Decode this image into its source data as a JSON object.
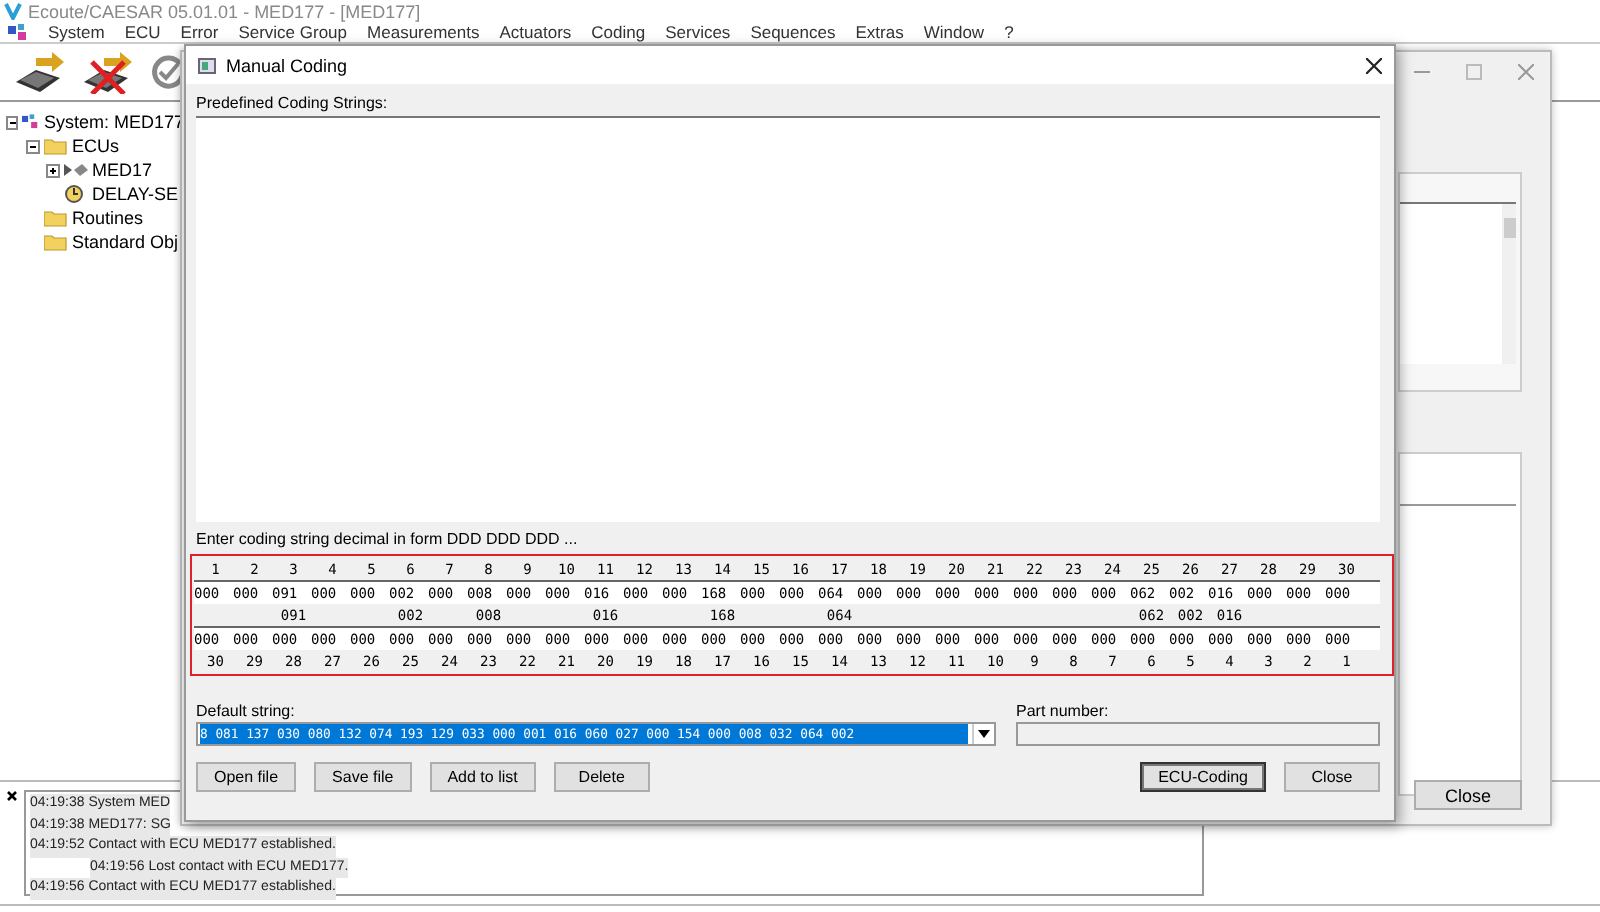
{
  "window": {
    "title": "Ecoute/CAESAR 05.01.01 - MED177 - [MED177]"
  },
  "menu": [
    "System",
    "ECU",
    "Error",
    "Service Group",
    "Measurements",
    "Actuators",
    "Coding",
    "Services",
    "Sequences",
    "Extras",
    "Window",
    "?"
  ],
  "tree": [
    {
      "label": "System: MED177",
      "kind": "system",
      "expanded": true,
      "children": [
        {
          "label": "ECUs",
          "kind": "folder",
          "expanded": true,
          "children": [
            {
              "label": "MED17",
              "kind": "ecu",
              "expanded": false
            },
            {
              "label": "DELAY-SE",
              "kind": "delay"
            }
          ]
        },
        {
          "label": "Routines",
          "kind": "folder"
        },
        {
          "label": "Standard Obj",
          "kind": "folder"
        }
      ]
    }
  ],
  "back_window": {
    "button": "Close"
  },
  "dialog": {
    "title": "Manual Coding",
    "predefined_label": "Predefined Coding Strings:",
    "coding_label": "Enter coding string decimal in form DDD DDD DDD ...",
    "columns": [
      {
        "number": "1",
        "value": "000",
        "bottom_value": "000",
        "bottom_number": "30"
      },
      {
        "number": "2",
        "value": "000",
        "bottom_value": "000",
        "bottom_number": "29"
      },
      {
        "number": "3",
        "value": "091",
        "changed": "091",
        "bottom_value": "000",
        "bottom_number": "28"
      },
      {
        "number": "4",
        "value": "000",
        "bottom_value": "000",
        "bottom_number": "27"
      },
      {
        "number": "5",
        "value": "000",
        "bottom_value": "000",
        "bottom_number": "26"
      },
      {
        "number": "6",
        "value": "002",
        "changed": "002",
        "bottom_value": "000",
        "bottom_number": "25"
      },
      {
        "number": "7",
        "value": "000",
        "bottom_value": "000",
        "bottom_number": "24"
      },
      {
        "number": "8",
        "value": "008",
        "changed": "008",
        "bottom_value": "000",
        "bottom_number": "23"
      },
      {
        "number": "9",
        "value": "000",
        "bottom_value": "000",
        "bottom_number": "22"
      },
      {
        "number": "10",
        "value": "000",
        "bottom_value": "000",
        "bottom_number": "21"
      },
      {
        "number": "11",
        "value": "016",
        "changed": "016",
        "bottom_value": "000",
        "bottom_number": "20"
      },
      {
        "number": "12",
        "value": "000",
        "bottom_value": "000",
        "bottom_number": "19"
      },
      {
        "number": "13",
        "value": "000",
        "bottom_value": "000",
        "bottom_number": "18"
      },
      {
        "number": "14",
        "value": "168",
        "changed": "168",
        "bottom_value": "000",
        "bottom_number": "17"
      },
      {
        "number": "15",
        "value": "000",
        "bottom_value": "000",
        "bottom_number": "16"
      },
      {
        "number": "16",
        "value": "000",
        "bottom_value": "000",
        "bottom_number": "15"
      },
      {
        "number": "17",
        "value": "064",
        "changed": "064",
        "bottom_value": "000",
        "bottom_number": "14"
      },
      {
        "number": "18",
        "value": "000",
        "bottom_value": "000",
        "bottom_number": "13"
      },
      {
        "number": "19",
        "value": "000",
        "bottom_value": "000",
        "bottom_number": "12"
      },
      {
        "number": "20",
        "value": "000",
        "bottom_value": "000",
        "bottom_number": "11"
      },
      {
        "number": "21",
        "value": "000",
        "bottom_value": "000",
        "bottom_number": "10"
      },
      {
        "number": "22",
        "value": "000",
        "bottom_value": "000",
        "bottom_number": "9"
      },
      {
        "number": "23",
        "value": "000",
        "bottom_value": "000",
        "bottom_number": "8"
      },
      {
        "number": "24",
        "value": "000",
        "bottom_value": "000",
        "bottom_number": "7"
      },
      {
        "number": "25",
        "value": "062",
        "changed": "062",
        "bottom_value": "000",
        "bottom_number": "6"
      },
      {
        "number": "26",
        "value": "002",
        "changed": "002",
        "bottom_value": "000",
        "bottom_number": "5"
      },
      {
        "number": "27",
        "value": "016",
        "changed": "016",
        "bottom_value": "000",
        "bottom_number": "4"
      },
      {
        "number": "28",
        "value": "000",
        "bottom_value": "000",
        "bottom_number": "3"
      },
      {
        "number": "29",
        "value": "000",
        "bottom_value": "000",
        "bottom_number": "2"
      },
      {
        "number": "30",
        "value": "000",
        "bottom_value": "000",
        "bottom_number": "1"
      }
    ],
    "default_label": "Default string:",
    "default_value": "8 081 137 030 080 132 074 193 129 033 000 001 016 060 027 000 154 000 008 032 064 002",
    "part_label": "Part number:",
    "buttons": [
      {
        "label": "Open file",
        "default": false
      },
      {
        "label": "Save file",
        "default": false
      },
      {
        "label": "Add to list",
        "default": false
      },
      {
        "label": "Delete",
        "default": false
      },
      {
        "label": "ECU-Coding",
        "default": true
      },
      {
        "label": "Close",
        "default": false
      }
    ]
  },
  "log": [
    {
      "text": "04:19:38 System MED",
      "indented": false
    },
    {
      "text": "04:19:38 MED177: SG",
      "indented": false
    },
    {
      "text": "04:19:52 Contact with ECU MED177 established.",
      "indented": false
    },
    {
      "text": "04:19:56 Lost contact with ECU MED177.",
      "indented": true
    },
    {
      "text": "04:19:56 Contact with ECU MED177 established.",
      "indented": false
    }
  ]
}
